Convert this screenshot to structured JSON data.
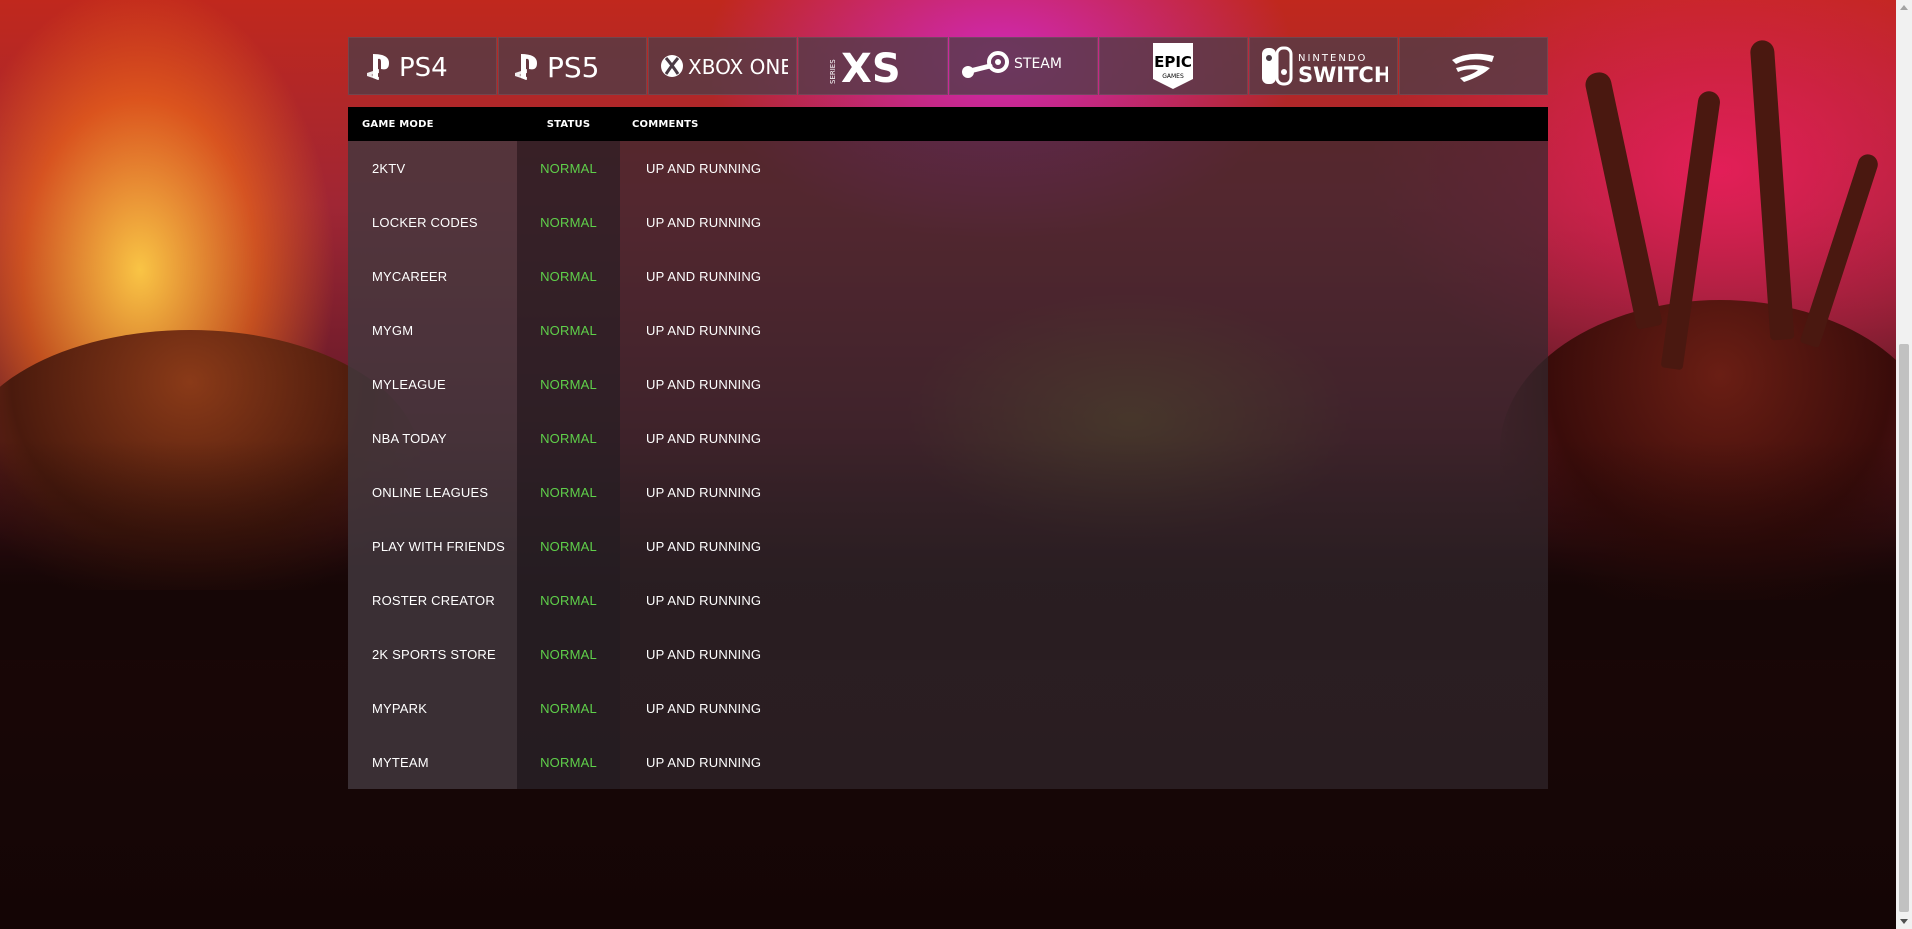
{
  "platforms": [
    {
      "name": "ps4-logo",
      "label": "PS4"
    },
    {
      "name": "ps5-logo",
      "label": "PS5"
    },
    {
      "name": "xbox-one-logo",
      "label": "XBOX ONE"
    },
    {
      "name": "xbox-series-xs-logo",
      "label": "XS",
      "sub": "SERIES"
    },
    {
      "name": "steam-logo",
      "label": "STEAM"
    },
    {
      "name": "epic-games-logo",
      "label": "EPIC",
      "sub": "GAMES"
    },
    {
      "name": "nintendo-switch-logo",
      "label": "SWITCH",
      "sub": "NINTENDO"
    },
    {
      "name": "stadia-logo",
      "label": ""
    }
  ],
  "table": {
    "headers": {
      "mode": "GAME MODE",
      "status": "STATUS",
      "comments": "COMMENTS"
    },
    "rows": [
      {
        "mode": "2KTV",
        "status": "NORMAL",
        "comment": "UP AND RUNNING"
      },
      {
        "mode": "LOCKER CODES",
        "status": "NORMAL",
        "comment": "UP AND RUNNING"
      },
      {
        "mode": "MYCAREER",
        "status": "NORMAL",
        "comment": "UP AND RUNNING"
      },
      {
        "mode": "MYGM",
        "status": "NORMAL",
        "comment": "UP AND RUNNING"
      },
      {
        "mode": "MYLEAGUE",
        "status": "NORMAL",
        "comment": "UP AND RUNNING"
      },
      {
        "mode": "NBA TODAY",
        "status": "NORMAL",
        "comment": "UP AND RUNNING"
      },
      {
        "mode": "ONLINE LEAGUES",
        "status": "NORMAL",
        "comment": "UP AND RUNNING"
      },
      {
        "mode": "PLAY WITH FRIENDS",
        "status": "NORMAL",
        "comment": "UP AND RUNNING"
      },
      {
        "mode": "ROSTER CREATOR",
        "status": "NORMAL",
        "comment": "UP AND RUNNING"
      },
      {
        "mode": "2K SPORTS STORE",
        "status": "NORMAL",
        "comment": "UP AND RUNNING"
      },
      {
        "mode": "MYPARK",
        "status": "NORMAL",
        "comment": "UP AND RUNNING"
      },
      {
        "mode": "MYTEAM",
        "status": "NORMAL",
        "comment": "UP AND RUNNING"
      }
    ]
  },
  "colors": {
    "status_normal": "#5fd04a",
    "header_bg": "#000000"
  }
}
